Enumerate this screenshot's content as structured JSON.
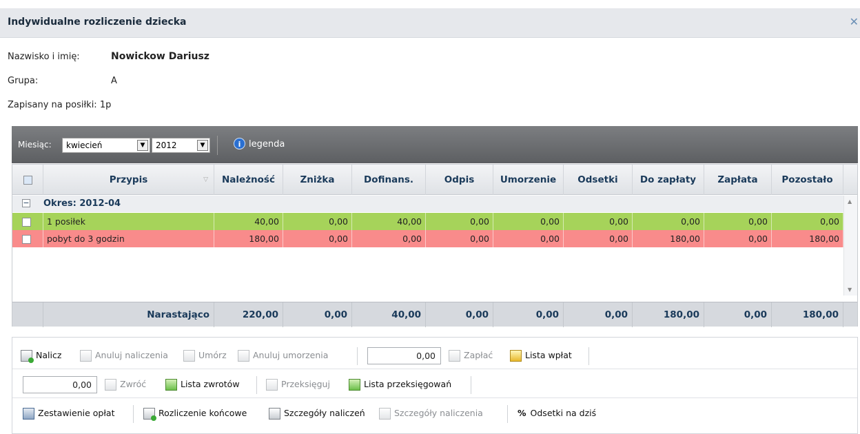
{
  "dialog": {
    "title": "Indywidualne rozliczenie dziecka",
    "close_icon": "close-icon"
  },
  "info": {
    "name_label": "Nazwisko i imię:",
    "name_value": "Nowickow Dariusz",
    "group_label": "Grupa:",
    "group_value": "A",
    "meals_label": "Zapisany na posiłki:",
    "meals_value": "1p"
  },
  "filters": {
    "month_label": "Miesiąc:",
    "month_value": "kwiecień",
    "year_value": "2012",
    "legend_label": "legenda"
  },
  "grid": {
    "columns": [
      "Przypis",
      "Należność",
      "Zniżka",
      "Dofinans.",
      "Odpis",
      "Umorzenie",
      "Odsetki",
      "Do zapłaty",
      "Zapłata",
      "Pozostało"
    ],
    "group_label": "Okres: 2012-04",
    "rows": [
      {
        "name": "1 posiłek",
        "values": [
          "40,00",
          "0,00",
          "40,00",
          "0,00",
          "0,00",
          "0,00",
          "0,00",
          "0,00",
          "0,00"
        ],
        "color": "#a6d35a"
      },
      {
        "name": "pobyt do 3 godzin",
        "values": [
          "180,00",
          "0,00",
          "0,00",
          "0,00",
          "0,00",
          "0,00",
          "180,00",
          "0,00",
          "180,00"
        ],
        "color": "#f98b8b"
      }
    ],
    "footer": {
      "label": "Narastająco",
      "values": [
        "220,00",
        "0,00",
        "40,00",
        "0,00",
        "0,00",
        "0,00",
        "180,00",
        "0,00",
        "180,00"
      ]
    }
  },
  "actions": {
    "row1": {
      "nalicz": "Nalicz",
      "anuluj_naliczenia": "Anuluj naliczenia",
      "umorz": "Umórz",
      "anuluj_umorzenia": "Anuluj umorzenia",
      "amount": "0,00",
      "zaplac": "Zapłać",
      "lista_wplat": "Lista wpłat"
    },
    "row2": {
      "amount": "0,00",
      "zwroc": "Zwróć",
      "lista_zwrotow": "Lista zwrotów",
      "przeksieguj": "Przeksięguj",
      "lista_przeksiegowan": "Lista przeksięgowań"
    },
    "row3": {
      "zestawienie": "Zestawienie opłat",
      "rozliczenie": "Rozliczenie końcowe",
      "szczegoly_naliczen": "Szczegóły naliczeń",
      "szczegoly_naliczenia": "Szczegóły naliczenia",
      "odsetki": "Odsetki na dziś"
    }
  }
}
